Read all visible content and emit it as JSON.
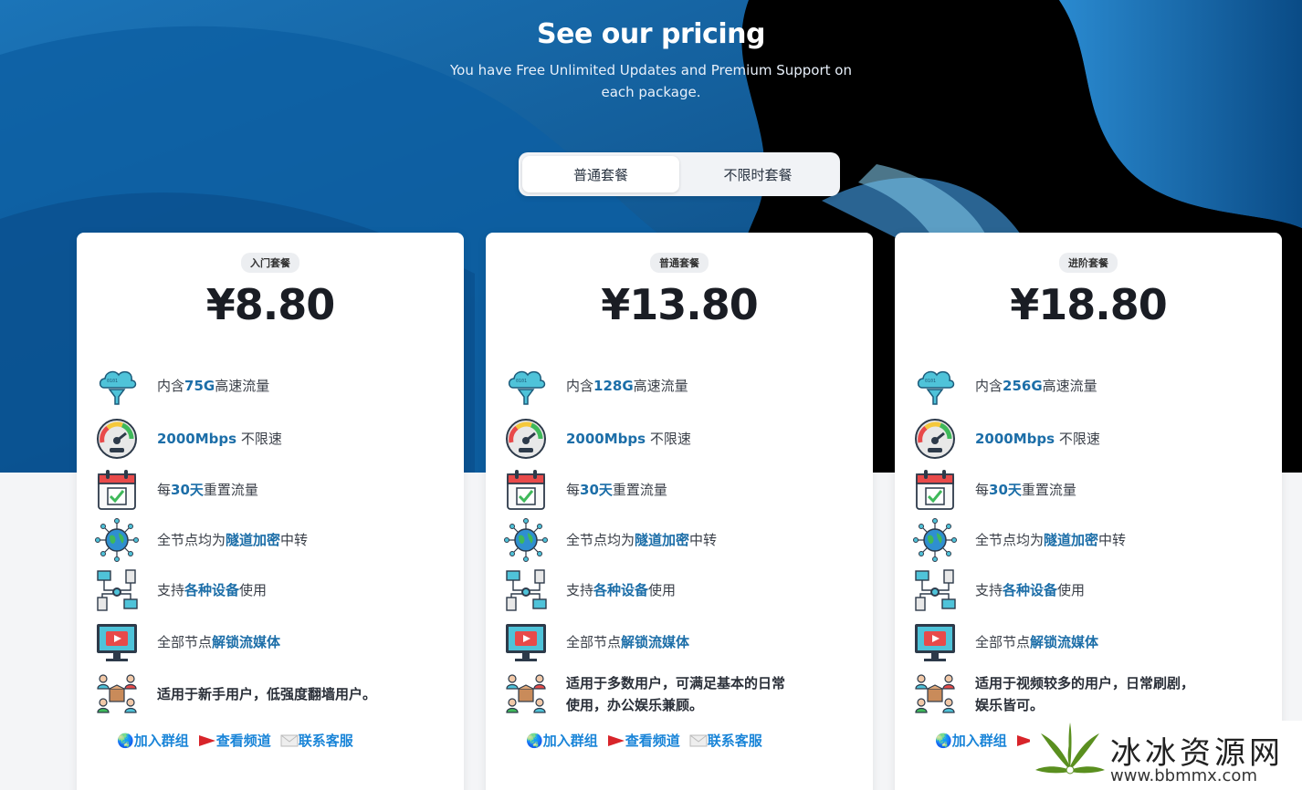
{
  "header": {
    "title": "See our pricing",
    "subtitle": "You have Free Unlimited Updates and Premium Support on each package."
  },
  "toggle": {
    "options": [
      "普通套餐",
      "不限时套餐"
    ],
    "selected": "普通套餐"
  },
  "colors": {
    "hero": "#0b5f9c",
    "accent": "#1c6ea8",
    "link": "#1a85d8"
  },
  "plans": [
    {
      "badge": "入门套餐",
      "price": "¥8.80",
      "f1": {
        "pre": "内含",
        "hl": "75G",
        "post": "高速流量"
      },
      "f2": {
        "hl": "2000Mbps",
        "post": " 不限速"
      },
      "f3": {
        "pre": "每",
        "hl": "30天",
        "post": "重置流量"
      },
      "f4": {
        "pre": "全节点均为",
        "hl": "隧道加密",
        "post": "中转"
      },
      "f5": {
        "pre": "支持",
        "hl": "各种设备",
        "post": "使用"
      },
      "f6": {
        "pre": "全部节点",
        "hl": "解锁流媒体"
      },
      "f7": "适用于新手用户，低强度翻墙用户。"
    },
    {
      "badge": "普通套餐",
      "price": "¥13.80",
      "f1": {
        "pre": "内含",
        "hl": "128G",
        "post": "高速流量"
      },
      "f2": {
        "hl": "2000Mbps",
        "post": " 不限速"
      },
      "f3": {
        "pre": "每",
        "hl": "30天",
        "post": "重置流量"
      },
      "f4": {
        "pre": "全节点均为",
        "hl": "隧道加密",
        "post": "中转"
      },
      "f5": {
        "pre": "支持",
        "hl": "各种设备",
        "post": "使用"
      },
      "f6": {
        "pre": "全部节点",
        "hl": "解锁流媒体"
      },
      "f7": "适用于多数用户，可满足基本的日常使用，办公娱乐兼顾。"
    },
    {
      "badge": "进阶套餐",
      "price": "¥18.80",
      "f1": {
        "pre": "内含",
        "hl": "256G",
        "post": "高速流量"
      },
      "f2": {
        "hl": "2000Mbps",
        "post": " 不限速"
      },
      "f3": {
        "pre": "每",
        "hl": "30天",
        "post": "重置流量"
      },
      "f4": {
        "pre": "全节点均为",
        "hl": "隧道加密",
        "post": "中转"
      },
      "f5": {
        "pre": "支持",
        "hl": "各种设备",
        "post": "使用"
      },
      "f6": {
        "pre": "全部节点",
        "hl": "解锁流媒体"
      },
      "f7": "适用于视频较多的用户，日常刷剧，娱乐皆可。"
    }
  ],
  "links": {
    "join": "加入群组",
    "channel": "查看频道",
    "contact": "联系客服"
  },
  "watermark": {
    "name": "冰冰资源网",
    "url": "www.bbmmx.com"
  }
}
